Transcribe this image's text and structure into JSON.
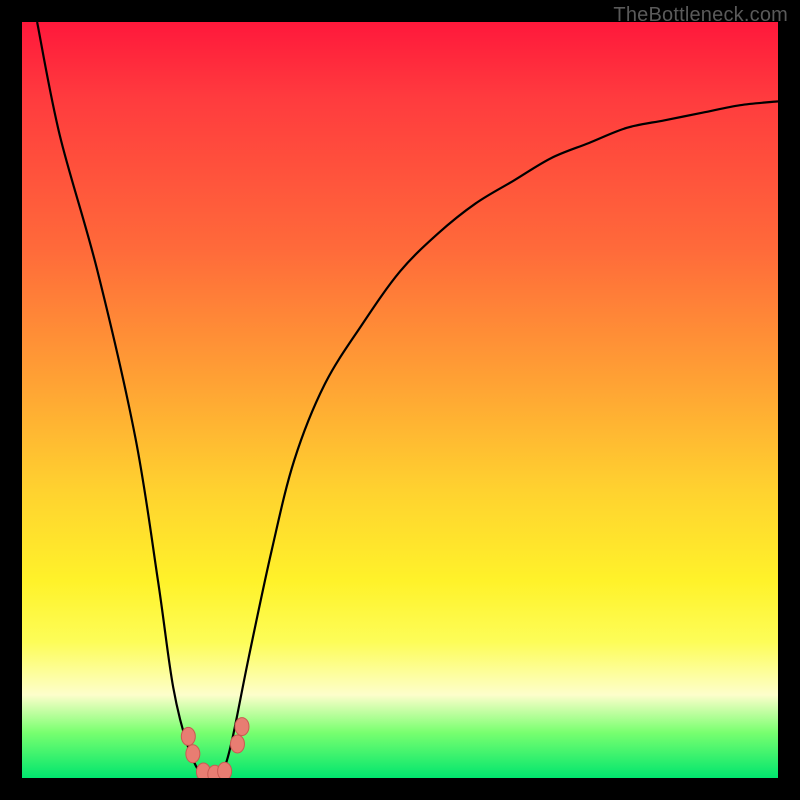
{
  "watermark": "TheBottleneck.com",
  "chart_data": {
    "type": "line",
    "title": "",
    "xlabel": "",
    "ylabel": "",
    "xlim": [
      0,
      100
    ],
    "ylim": [
      0,
      100
    ],
    "series": [
      {
        "name": "bottleneck-curve",
        "x": [
          2,
          5,
          10,
          15,
          18,
          20,
          22,
          24,
          25,
          26,
          27,
          28,
          30,
          33,
          36,
          40,
          45,
          50,
          55,
          60,
          65,
          70,
          75,
          80,
          85,
          90,
          95,
          100
        ],
        "values": [
          100,
          85,
          67,
          45,
          26,
          12,
          4,
          0,
          0,
          0,
          2,
          6,
          16,
          30,
          42,
          52,
          60,
          67,
          72,
          76,
          79,
          82,
          84,
          86,
          87,
          88,
          89,
          89.5
        ]
      }
    ],
    "markers": [
      {
        "name": "marker-a",
        "x": 22.0,
        "y": 5.5
      },
      {
        "name": "marker-b",
        "x": 22.6,
        "y": 3.2
      },
      {
        "name": "marker-c",
        "x": 24.0,
        "y": 0.8
      },
      {
        "name": "marker-d",
        "x": 25.5,
        "y": 0.5
      },
      {
        "name": "marker-e",
        "x": 26.8,
        "y": 0.9
      },
      {
        "name": "marker-f",
        "x": 28.5,
        "y": 4.5
      },
      {
        "name": "marker-g",
        "x": 29.1,
        "y": 6.8
      }
    ],
    "colors": {
      "curve": "#000000",
      "marker_fill": "#e87d72",
      "marker_stroke": "#c95a52"
    }
  }
}
